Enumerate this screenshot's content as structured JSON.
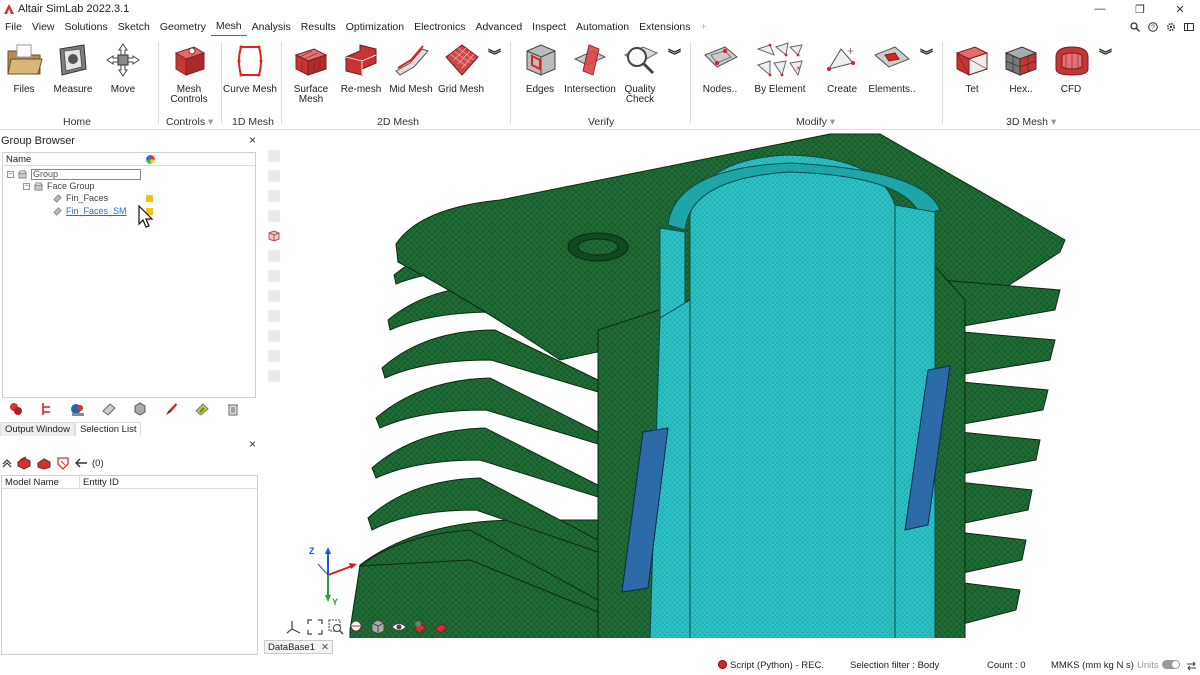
{
  "window": {
    "title": "Altair SimLab 2022.3.1",
    "controls": [
      "—",
      "❐",
      "✕"
    ]
  },
  "menubar": {
    "items": [
      "File",
      "View",
      "Solutions",
      "Sketch",
      "Geometry",
      "Mesh",
      "Analysis",
      "Results",
      "Optimization",
      "Electronics",
      "Advanced",
      "Inspect",
      "Automation",
      "Extensions",
      "+"
    ],
    "active": "Mesh"
  },
  "ribbon": {
    "tools": [
      {
        "label": "Files",
        "icon": "folder-icon"
      },
      {
        "label": "Measure",
        "icon": "measure-icon"
      },
      {
        "label": "Move",
        "icon": "move-icon"
      },
      {
        "label": "Mesh Controls",
        "icon": "mesh-controls-icon"
      },
      {
        "label": "Curve Mesh",
        "icon": "curve-mesh-icon"
      },
      {
        "label": "Surface Mesh",
        "icon": "surface-mesh-icon"
      },
      {
        "label": "Re-mesh",
        "icon": "remesh-icon"
      },
      {
        "label": "Mid Mesh",
        "icon": "mid-mesh-icon"
      },
      {
        "label": "Grid Mesh",
        "icon": "grid-mesh-icon"
      },
      {
        "label": "Edges",
        "icon": "edges-icon"
      },
      {
        "label": "Intersection",
        "icon": "intersection-icon"
      },
      {
        "label": "Quality Check",
        "icon": "quality-check-icon"
      },
      {
        "label": "Nodes..",
        "icon": "nodes-icon"
      },
      {
        "label": "By Element",
        "icon": "by-element-icon"
      },
      {
        "label": "Create",
        "icon": "create-icon"
      },
      {
        "label": "Elements..",
        "icon": "elements-icon"
      },
      {
        "label": "Tet",
        "icon": "tet-icon"
      },
      {
        "label": "Hex..",
        "icon": "hex-icon"
      },
      {
        "label": "CFD",
        "icon": "cfd-icon"
      }
    ],
    "groups": [
      "Home",
      "Controls",
      "1D Mesh",
      "2D Mesh",
      "Verify",
      "Modify",
      "3D Mesh"
    ],
    "group_menu_glyph": "▾",
    "expand_glyph": "︾"
  },
  "group_browser": {
    "title": "Group Browser",
    "close": "×",
    "column": "Name",
    "tree": {
      "root": "Group",
      "child": "Face Group",
      "leaves": [
        "Fin_Faces",
        "Fin_Faces_SM"
      ]
    },
    "expander_glyph": "−"
  },
  "bottom_panel": {
    "tabs": [
      "Output Window",
      "Selection List"
    ],
    "active_tab": "Selection List",
    "close": "×",
    "count_label": "(0)",
    "columns": [
      "Model Name",
      "Entity ID"
    ]
  },
  "viewport": {
    "axes": {
      "z": "Z",
      "y": "Y",
      "x": "X"
    }
  },
  "database_tab": {
    "label": "DataBase1",
    "close": "✕"
  },
  "statusbar": {
    "script": "Script (Python) - REC.",
    "filter": "Selection filter : Body",
    "count": "Count : 0",
    "units_system": "MMKS (mm kg N s)",
    "units_label": "Units"
  },
  "colors": {
    "fin_green": "#1f6b35",
    "bore_cyan": "#2cc2c5",
    "slot_blue": "#2d6aa8",
    "accent_blue": "#2a6fbf",
    "swatch_yellow": "#f2c316"
  }
}
